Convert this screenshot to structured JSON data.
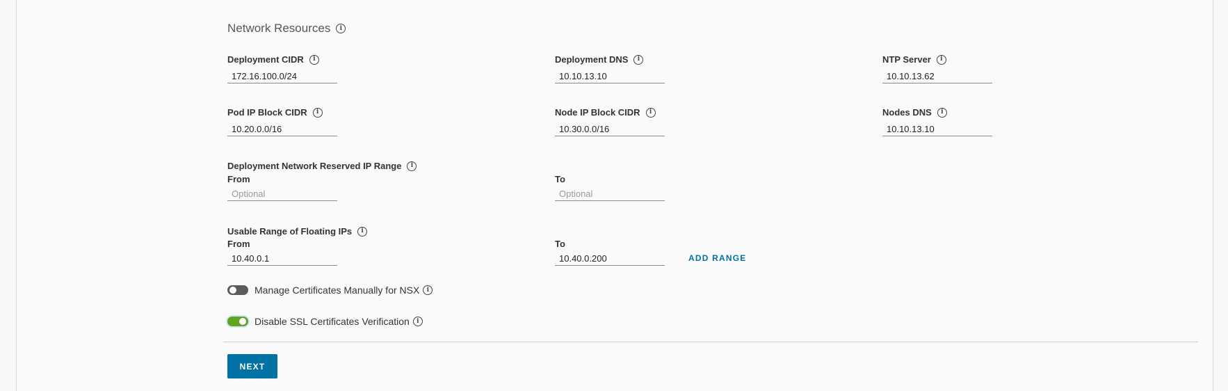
{
  "section": {
    "title": "Network Resources"
  },
  "fields": {
    "deployment_cidr": {
      "label": "Deployment CIDR",
      "value": "172.16.100.0/24"
    },
    "deployment_dns": {
      "label": "Deployment DNS",
      "value": "10.10.13.10"
    },
    "ntp_server": {
      "label": "NTP Server",
      "value": "10.10.13.62"
    },
    "pod_ip_block_cidr": {
      "label": "Pod IP Block CIDR",
      "value": "10.20.0.0/16"
    },
    "node_ip_block_cidr": {
      "label": "Node IP Block CIDR",
      "value": "10.30.0.0/16"
    },
    "nodes_dns": {
      "label": "Nodes DNS",
      "value": "10.10.13.10"
    }
  },
  "reserved_range": {
    "label": "Deployment Network Reserved IP Range",
    "from_label": "From",
    "to_label": "To",
    "from_placeholder": "Optional",
    "to_placeholder": "Optional",
    "from_value": "",
    "to_value": ""
  },
  "floating_range": {
    "label": "Usable Range of Floating IPs",
    "from_label": "From",
    "to_label": "To",
    "from_value": "10.40.0.1",
    "to_value": "10.40.0.200",
    "add_range_label": "ADD RANGE"
  },
  "toggles": {
    "manage_certs": {
      "label": "Manage Certificates Manually for NSX",
      "state": "off"
    },
    "disable_ssl": {
      "label": "Disable SSL Certificates Verification",
      "state": "on"
    }
  },
  "footer": {
    "next_label": "NEXT"
  },
  "icons": {
    "info": "info-icon",
    "info_glyph": "i"
  },
  "colors": {
    "primary": "#0072a3",
    "toggle_on": "#62a420",
    "toggle_off": "#5b5b5b"
  }
}
